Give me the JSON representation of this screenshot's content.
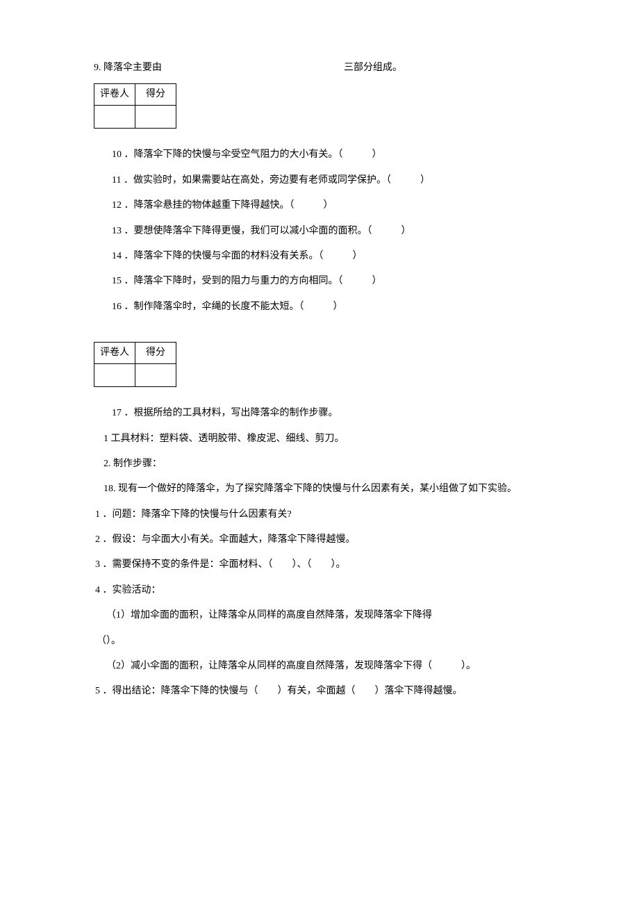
{
  "q9": {
    "left": "9. 降落伞主要由",
    "right": "三部分组成。"
  },
  "score": {
    "grader": "评卷人",
    "score": "得分"
  },
  "tf": {
    "q10": "10 ．降落伞下降的快慢与伞受空气阻力的大小有关。（　　　）",
    "q11": "11 ．做实验时，如果需要站在高处，旁边要有老师或同学保护。（　　　）",
    "q12": "12 ．降落伞悬挂的物体越重下降得越快。（　　　）",
    "q13": "13 ．要想使降落伞下降得更慢，我们可以减小伞面的面积。（　　　）",
    "q14": "14 ．降落伞下降的快慢与伞面的材料没有关系。（　　　）",
    "q15": "15 ．降落伞下降时，受到的阻力与重力的方向相同。（　　　）",
    "q16": "16 ．制作降落伞时，伞绳的长度不能太短。（　　　）"
  },
  "q17": {
    "prompt": "17 ．根据所给的工具材料，写出降落伞的制作步骤。",
    "line1": "1 工具材料：塑料袋、透明胶带、橡皮泥、细线、剪刀。",
    "line2": "2. 制作步骤："
  },
  "q18": {
    "intro": "18. 现有一个做好的降落伞，为了探究降落伞下降的快慢与什么因素有关，某小组做了如下实验。",
    "p1": "1 ．问题：降落伞下降的快慢与什么因素有关?",
    "p2": "2 ．假设：与伞面大小有关。伞面越大，降落伞下降得越慢。",
    "p3": "3 ．需要保持不变的条件是：伞面材料、（　　）、（　　）。",
    "p4": "4 ．实验活动：",
    "p4_1a": "（1）增加伞面的面积，让降落伞从同样的高度自然降落，发现降落伞下降得",
    "p4_1b": "（）。",
    "p4_2": "（2）减小伞面的面积，让降落伞从同样的高度自然降落，发现降落伞下得（　　　）。",
    "p5": "5 ．得出结论：降落伞下降的快慢与（　　）有关，伞面越（　　）落伞下降得越慢。"
  }
}
